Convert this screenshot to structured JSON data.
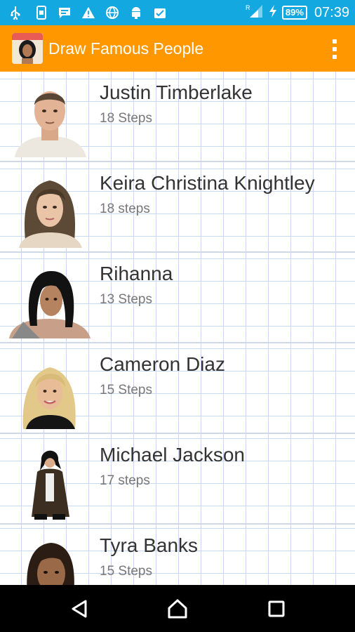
{
  "status_bar": {
    "battery": "89%",
    "time": "07:39",
    "icons": [
      "usb-icon",
      "sim-icon",
      "chat-icon",
      "warning-icon",
      "globe-icon",
      "android-icon",
      "clipboard-icon",
      "signal-icon",
      "charging-icon",
      "battery-icon"
    ]
  },
  "app_bar": {
    "title": "Draw Famous People",
    "overflow_icon": "more-vert-icon"
  },
  "people": [
    {
      "name": "Justin Timberlake",
      "steps": "18 Steps"
    },
    {
      "name": "Keira Christina Knightley",
      "steps": "18 steps"
    },
    {
      "name": "Rihanna",
      "steps": "13 Steps"
    },
    {
      "name": " Cameron Diaz",
      "steps": "15 Steps"
    },
    {
      "name": " Michael Jackson",
      "steps": "17 steps"
    },
    {
      "name": "Tyra Banks",
      "steps": "15 Steps"
    }
  ],
  "nav_bar": {
    "icons": [
      "back-icon",
      "home-icon",
      "recents-icon"
    ]
  },
  "colors": {
    "status_bar": "#14a8e0",
    "app_bar": "#ff9800",
    "grid": "#c9d9f2",
    "nav_bar": "#000000"
  }
}
